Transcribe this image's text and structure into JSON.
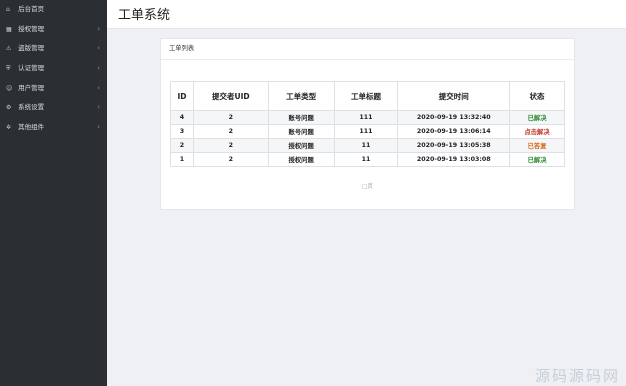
{
  "sidebar": {
    "items": [
      {
        "icon": "home-icon",
        "glyph": "⌂",
        "label": "后台首页",
        "chevron": ""
      },
      {
        "icon": "grid-icon",
        "glyph": "▦",
        "label": "授权管理",
        "chevron": "‹"
      },
      {
        "icon": "warning-icon",
        "glyph": "⚠",
        "label": "盗版管理",
        "chevron": "‹"
      },
      {
        "icon": "shield-icon",
        "glyph": "⛨",
        "label": "认证管理",
        "chevron": "‹"
      },
      {
        "icon": "user-icon",
        "glyph": "☺",
        "label": "用户管理",
        "chevron": "‹"
      },
      {
        "icon": "settings-icon",
        "glyph": "⚙",
        "label": "系统设置",
        "chevron": "‹"
      },
      {
        "icon": "gear-icon",
        "glyph": "✲",
        "label": "其他组件",
        "chevron": "‹"
      }
    ]
  },
  "header": {
    "title": "工单系统"
  },
  "panel": {
    "title": "工单列表",
    "table": {
      "columns": [
        "ID",
        "提交者UID",
        "工单类型",
        "工单标题",
        "提交时间",
        "状态"
      ],
      "rows": [
        [
          "4",
          "2",
          "账号问题",
          "111",
          "2020-09-19 13:32:40",
          "已解决"
        ],
        [
          "3",
          "2",
          "账号问题",
          "111",
          "2020-09-19 13:06:14",
          "点击解决"
        ],
        [
          "2",
          "2",
          "授权问题",
          "11",
          "2020-09-19 13:05:38",
          "已答复"
        ],
        [
          "1",
          "2",
          "授权问题",
          "11",
          "2020-09-19 13:03:08",
          "已解决"
        ]
      ],
      "status_colors": [
        "#2e8b2e",
        "#c0392b",
        "#d96a1c",
        "#2e8b2e"
      ]
    },
    "pager": "□页"
  },
  "watermark": "源码源码网"
}
